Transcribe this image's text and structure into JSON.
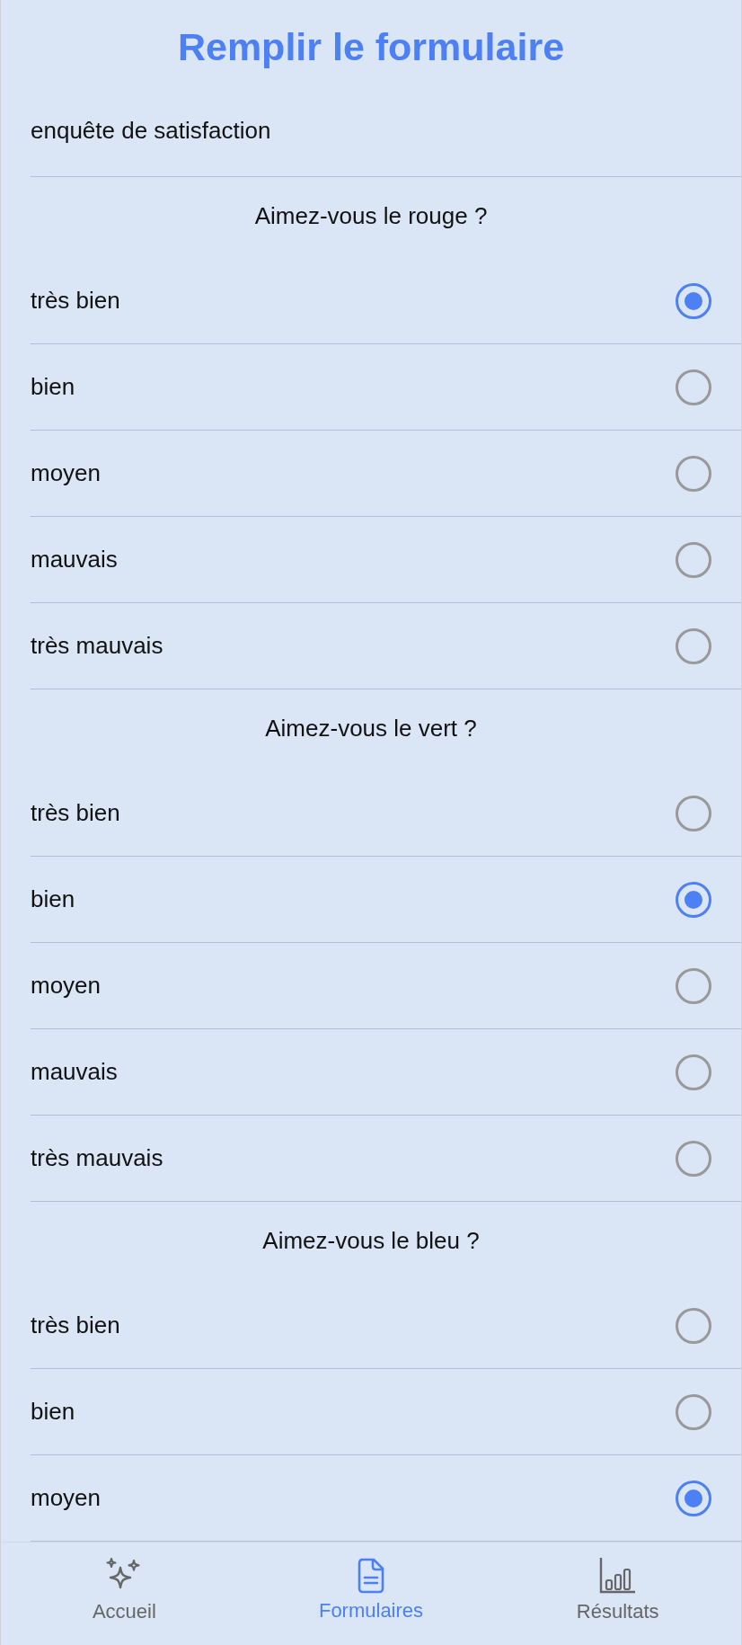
{
  "header": {
    "title": "Remplir le formulaire"
  },
  "form": {
    "name": "enquête de satisfaction"
  },
  "questions": [
    {
      "text": "Aimez-vous le rouge ?",
      "options": [
        {
          "label": "très bien",
          "selected": true
        },
        {
          "label": "bien",
          "selected": false
        },
        {
          "label": "moyen",
          "selected": false
        },
        {
          "label": "mauvais",
          "selected": false
        },
        {
          "label": "très mauvais",
          "selected": false
        }
      ]
    },
    {
      "text": "Aimez-vous le vert ?",
      "options": [
        {
          "label": "très bien",
          "selected": false
        },
        {
          "label": "bien",
          "selected": true
        },
        {
          "label": "moyen",
          "selected": false
        },
        {
          "label": "mauvais",
          "selected": false
        },
        {
          "label": "très mauvais",
          "selected": false
        }
      ]
    },
    {
      "text": "Aimez-vous le bleu ?",
      "options": [
        {
          "label": "très bien",
          "selected": false
        },
        {
          "label": "bien",
          "selected": false
        },
        {
          "label": "moyen",
          "selected": true
        }
      ]
    }
  ],
  "nav": [
    {
      "kind": "sparkles",
      "label": "Accueil",
      "selected": false
    },
    {
      "kind": "document",
      "label": "Formulaires",
      "selected": true
    },
    {
      "kind": "chart",
      "label": "Résultats",
      "selected": false
    }
  ]
}
